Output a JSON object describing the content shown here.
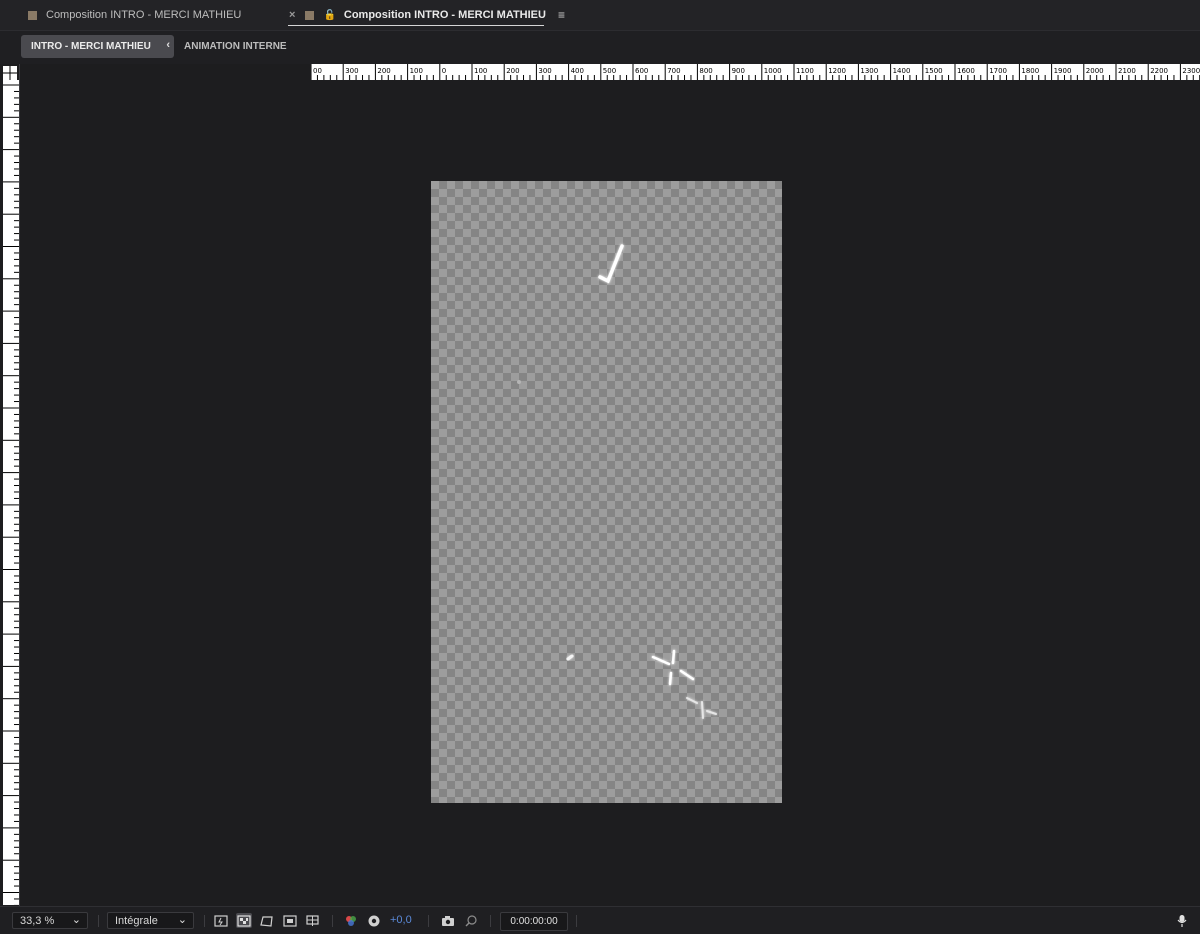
{
  "tabs": [
    {
      "label": "Composition INTRO - MERCI MATHIEU",
      "active": false
    },
    {
      "label": "Composition INTRO - MERCI MATHIEU",
      "active": true
    }
  ],
  "tab_icons": {
    "close": "×",
    "lock": "🔓",
    "menu": "≡"
  },
  "breadcrumb": {
    "items": [
      "INTRO - MERCI MATHIEU",
      "ANIMATION INTERNE"
    ],
    "chevron": "‹"
  },
  "ruler_top_labels": [
    "00",
    "300",
    "200",
    "100",
    "0",
    "100",
    "200",
    "300",
    "400",
    "500",
    "600",
    "700",
    "800",
    "900",
    "1000",
    "1100",
    "1200",
    "1300",
    "1400",
    "1500",
    "1600",
    "1700",
    "1800",
    "1900",
    "2000",
    "2100",
    "2200",
    "2300"
  ],
  "toolbar": {
    "zoom": "33,3 %",
    "resolution": "Intégrale",
    "exposure": "+0,0",
    "timecode": "0:00:00:00",
    "dropdown_glyph": "⌄"
  },
  "colors": {
    "background": "#1d1d1f",
    "transparency_light": "#9d9d9d",
    "transparency_dark": "#858585",
    "exposure_blue": "#5b8ad9"
  }
}
